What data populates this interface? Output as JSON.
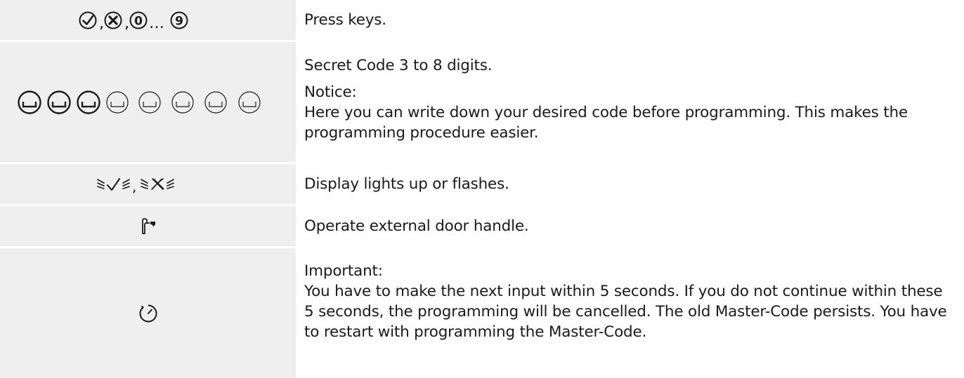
{
  "rows": [
    {
      "symbol_icon": "keys-icon",
      "symbol_text": {
        "sep": ",",
        "ellipsis": "…"
      },
      "description": "Press keys."
    },
    {
      "symbol_icon": "code-digit-fields-icon",
      "description": "Secret Code 3 to 8 digits.",
      "note_label": "Notice:",
      "note_text": "Here you can write down your desired code before programming. This makes the programming procedure easier."
    },
    {
      "symbol_icon": "display-lights-icon",
      "symbol_text": {
        "sep": ","
      },
      "description": "Display lights up or flashes."
    },
    {
      "symbol_icon": "door-handle-icon",
      "description": "Operate external door handle."
    },
    {
      "symbol_icon": "clock-icon",
      "note_label": "Important:",
      "note_text": "You have to make the next input within 5 seconds. If you do not continue within these 5 seconds, the programming will be cancelled. The old Master-Code persists. You have to restart with programming the Master-Code."
    }
  ],
  "key_digits": {
    "zero": "0",
    "nine": "9"
  }
}
